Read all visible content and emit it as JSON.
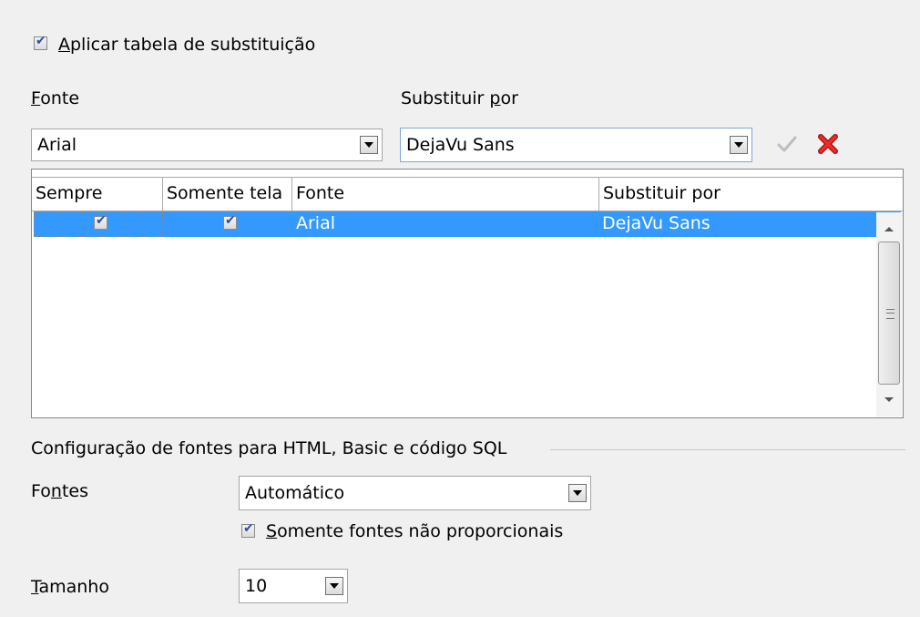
{
  "apply_table": {
    "label_prefix": "",
    "mnemonic": "A",
    "label_rest": "plicar tabela de substituição",
    "checked": true
  },
  "fonte_label": {
    "mnemonic": "F",
    "rest": "onte"
  },
  "substituir_label": {
    "before": "Substituir ",
    "mnemonic": "p",
    "after": "or"
  },
  "fonte_combo": {
    "value": "Arial"
  },
  "substituir_combo": {
    "value": "DejaVu Sans"
  },
  "icons": {
    "apply": "checkmark-icon",
    "delete": "delete-x-icon",
    "delete_color": "#e01b1b",
    "apply_color": "#b8b8b8"
  },
  "table": {
    "columns": [
      "Sempre",
      "Somente tela",
      "Fonte",
      "Substituir por"
    ],
    "rows": [
      {
        "sempre": true,
        "somente_tela": true,
        "fonte": "Arial",
        "substituir_por": "DejaVu Sans",
        "selected": true
      }
    ],
    "selection_color": "#3399ff"
  },
  "section": {
    "title": "Configuração de fontes para HTML, Basic e código SQL"
  },
  "fontes_label": {
    "before": "Fo",
    "mnemonic": "n",
    "after": "tes"
  },
  "fontes_combo": {
    "value": "Automático"
  },
  "mono_only": {
    "mnemonic": "S",
    "rest": "omente fontes não proporcionais",
    "checked": true
  },
  "tamanho_label": {
    "mnemonic": "T",
    "rest": "amanho"
  },
  "tamanho_combo": {
    "value": "10"
  }
}
